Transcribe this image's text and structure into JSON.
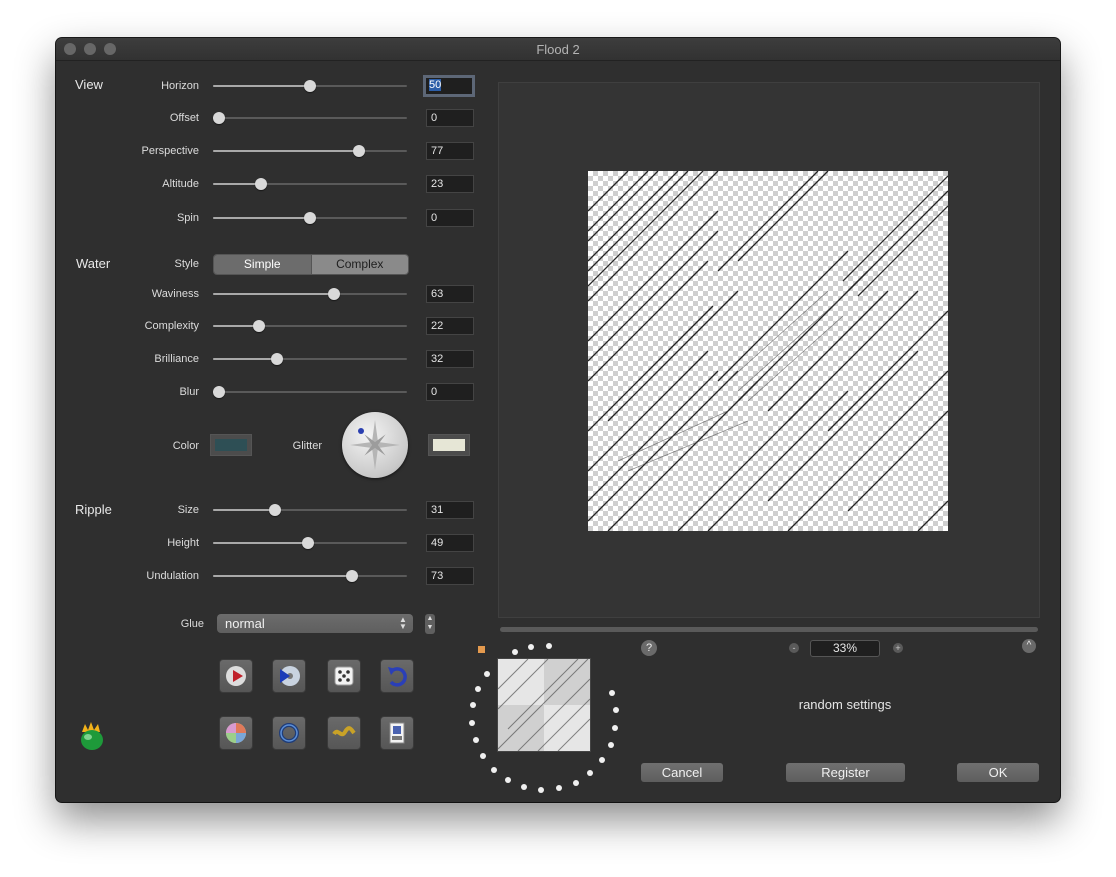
{
  "window": {
    "title": "Flood 2"
  },
  "view": {
    "label": "View",
    "rows": [
      {
        "label": "Horizon",
        "value": "50",
        "percent": 50
      },
      {
        "label": "Offset",
        "value": "0",
        "percent": 0
      },
      {
        "label": "Perspective",
        "value": "77",
        "percent": 77
      },
      {
        "label": "Altitude",
        "value": "23",
        "percent": 23
      },
      {
        "label": "Spin",
        "value": "0",
        "percent": 50
      }
    ]
  },
  "water": {
    "label": "Water",
    "style_label": "Style",
    "style_options": [
      "Simple",
      "Complex"
    ],
    "style_selected": "Simple",
    "rows": [
      {
        "label": "Waviness",
        "value": "63",
        "percent": 63
      },
      {
        "label": "Complexity",
        "value": "22",
        "percent": 22
      },
      {
        "label": "Brilliance",
        "value": "32",
        "percent": 32
      },
      {
        "label": "Blur",
        "value": "0",
        "percent": 0
      }
    ],
    "color_label": "Color",
    "color_value": "#2e4f55",
    "glitter_label": "Glitter",
    "glitter_value": "#e6e6d6"
  },
  "ripple": {
    "label": "Ripple",
    "rows": [
      {
        "label": "Size",
        "value": "31",
        "percent": 31
      },
      {
        "label": "Height",
        "value": "49",
        "percent": 49
      },
      {
        "label": "Undulation",
        "value": "73",
        "percent": 73
      }
    ]
  },
  "glue": {
    "label": "Glue",
    "value": "normal"
  },
  "toolbar": {
    "row1_icons": [
      "play-disc-icon",
      "disc-arrow-icon",
      "dice-icon",
      "undo-arrow-icon"
    ],
    "row2_icons": [
      "color-wheel-icon",
      "ring-icon",
      "wave-icon",
      "psd-file-icon"
    ],
    "logo_icon": "flame-egg-logo-icon"
  },
  "preview": {
    "zoom": "33%",
    "help_label": "?",
    "zoom_out_label": "-",
    "zoom_in_label": "+",
    "collapse_label": "^",
    "status": "random settings"
  },
  "buttons": {
    "cancel": "Cancel",
    "register": "Register",
    "ok": "OK"
  },
  "colors": {
    "window_bg": "#2f2f2f",
    "selection": "#2c5ea8"
  }
}
